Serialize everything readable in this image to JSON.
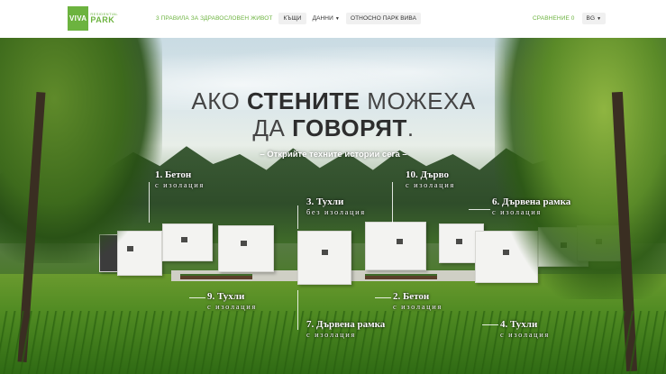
{
  "header": {
    "logo": {
      "word1": "VIVA",
      "word2": "PARK",
      "small": "RESIDENTIAL"
    },
    "nav": [
      {
        "label": "3 ПРАВИЛА ЗА ЗДРАВОСЛОВЕН ЖИВОТ",
        "style": "green"
      },
      {
        "label": "КЪЩИ",
        "style": "boxed"
      },
      {
        "label": "ДАННИ",
        "style": "plain",
        "dropdown": true
      },
      {
        "label": "ОТНОСНО ПАРК ВИВА",
        "style": "boxed"
      }
    ],
    "compare_label": "СРАВНЕНИЕ 0",
    "language": "BG"
  },
  "hero": {
    "headline_line1_pre": "АКО ",
    "headline_line1_bold": "СТЕНИТЕ",
    "headline_line1_post": " МОЖЕХА",
    "headline_line2_pre": "ДА ",
    "headline_line2_bold": "ГОВОРЯТ",
    "headline_line2_post": ".",
    "subheading": "– Открийте техните истории сега –",
    "labels": [
      {
        "title": "1. Бетон",
        "subtitle": "с изолация"
      },
      {
        "title": "10. Дърво",
        "subtitle": "с изолация"
      },
      {
        "title": "3. Тухли",
        "subtitle": "без изолация"
      },
      {
        "title": "6. Дървена рамка",
        "subtitle": "с изолация"
      },
      {
        "title": "9. Тухли",
        "subtitle": "с изолация"
      },
      {
        "title": "2. Бетон",
        "subtitle": "с изолация"
      },
      {
        "title": "7. Дървена рамка",
        "subtitle": "с изолация"
      },
      {
        "title": "4. Тухли",
        "subtitle": "с изолация"
      }
    ]
  },
  "colors": {
    "brand_green": "#6cb33f"
  }
}
